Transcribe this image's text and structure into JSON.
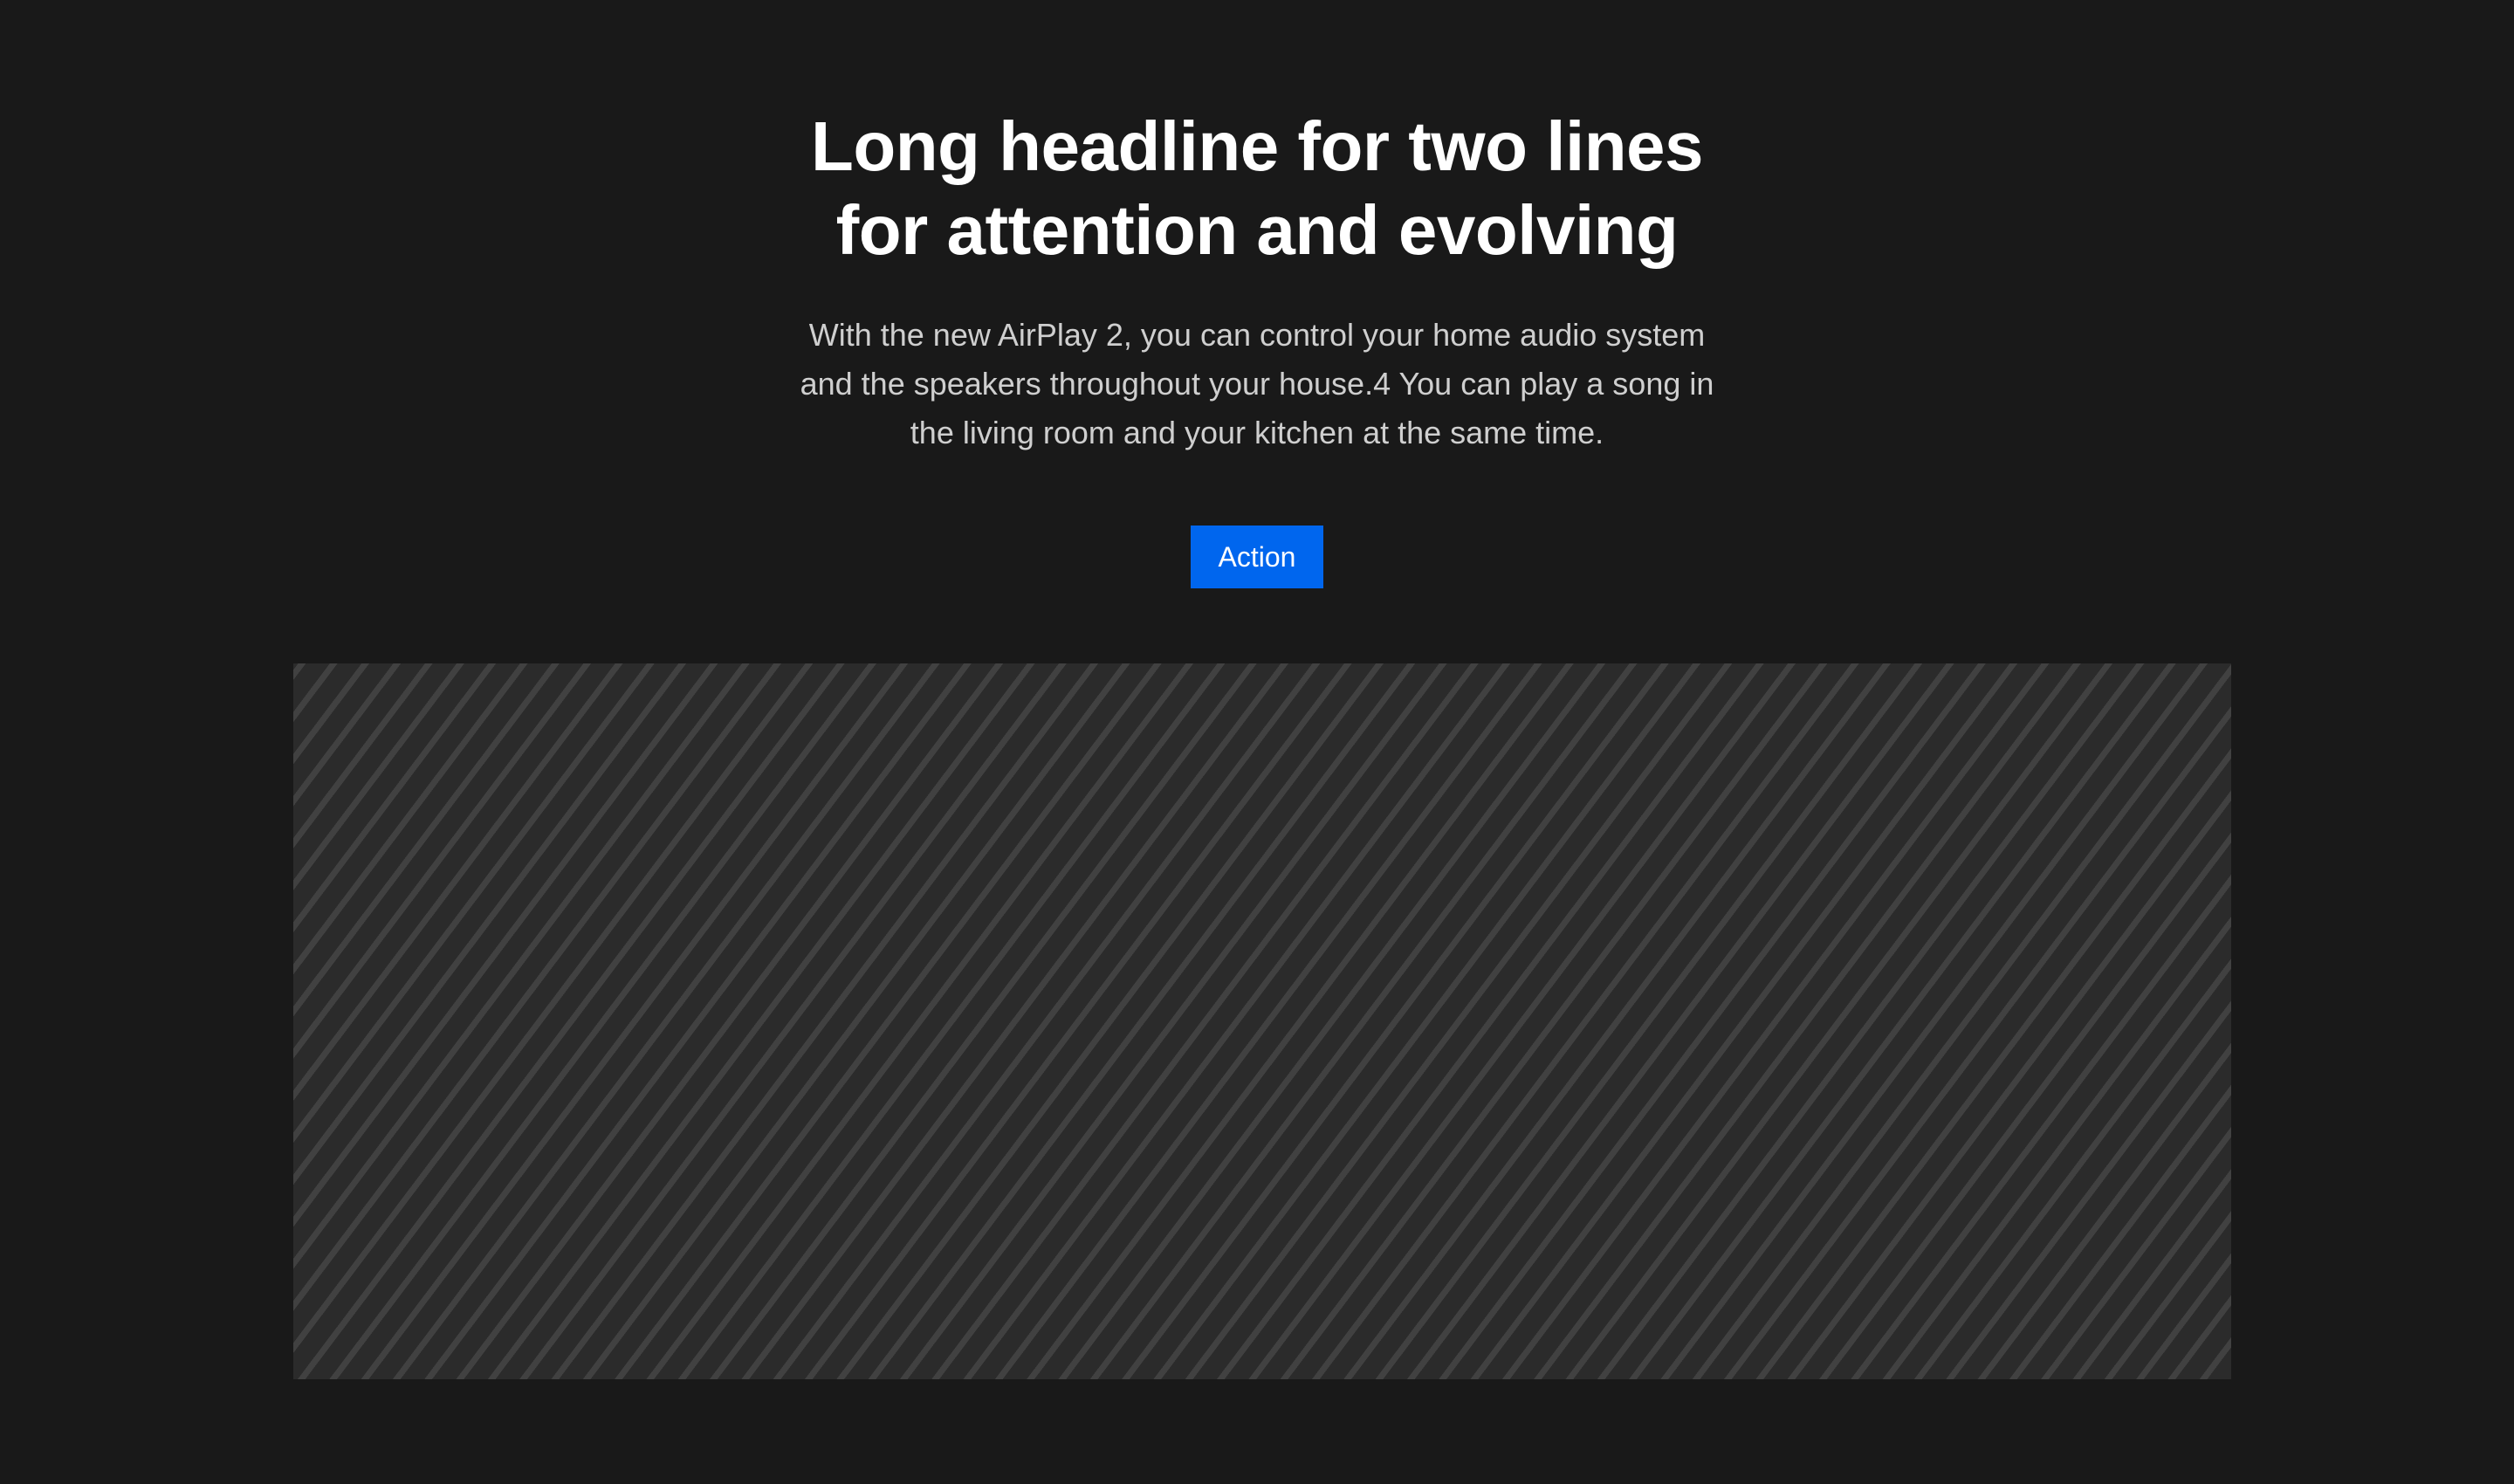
{
  "hero": {
    "headline_lines": [
      "Long headline for two lines",
      "for attention and evolving"
    ],
    "body_lines": [
      "With the new AirPlay 2, you can control your home audio system",
      "and the speakers throughout your house.4 You can play a song in",
      "the living room and your kitchen at the same time."
    ],
    "action_label": "Action"
  },
  "colors": {
    "background": "#191919",
    "headline": "#ffffff",
    "body_text": "#cfcfcf",
    "button_background": "#0066ee",
    "button_text": "#ffffff",
    "placeholder_base": "#2b2b2b",
    "placeholder_stripe": "#414141"
  }
}
